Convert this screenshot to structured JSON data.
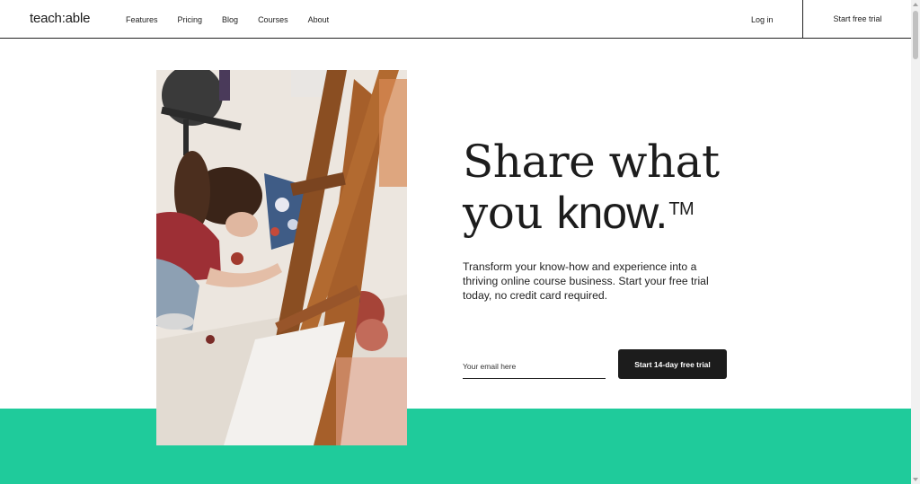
{
  "nav": {
    "logo": "teach:able",
    "links": [
      "Features",
      "Pricing",
      "Blog",
      "Courses",
      "About"
    ],
    "login": "Log in",
    "start_trial": "Start free trial"
  },
  "hero": {
    "headline_line1": "Share what",
    "headline_line2_a": "you ",
    "headline_line2_b": "know.",
    "trademark": "TM",
    "subtext": "Transform your know-how and experience into a thriving online course business. Start your free trial today, no credit card required.",
    "email_placeholder": "Your email here",
    "cta_label": "Start 14-day free trial"
  },
  "colors": {
    "accent_green": "#1fcb9b",
    "cta_bg": "#1c1c1c"
  }
}
